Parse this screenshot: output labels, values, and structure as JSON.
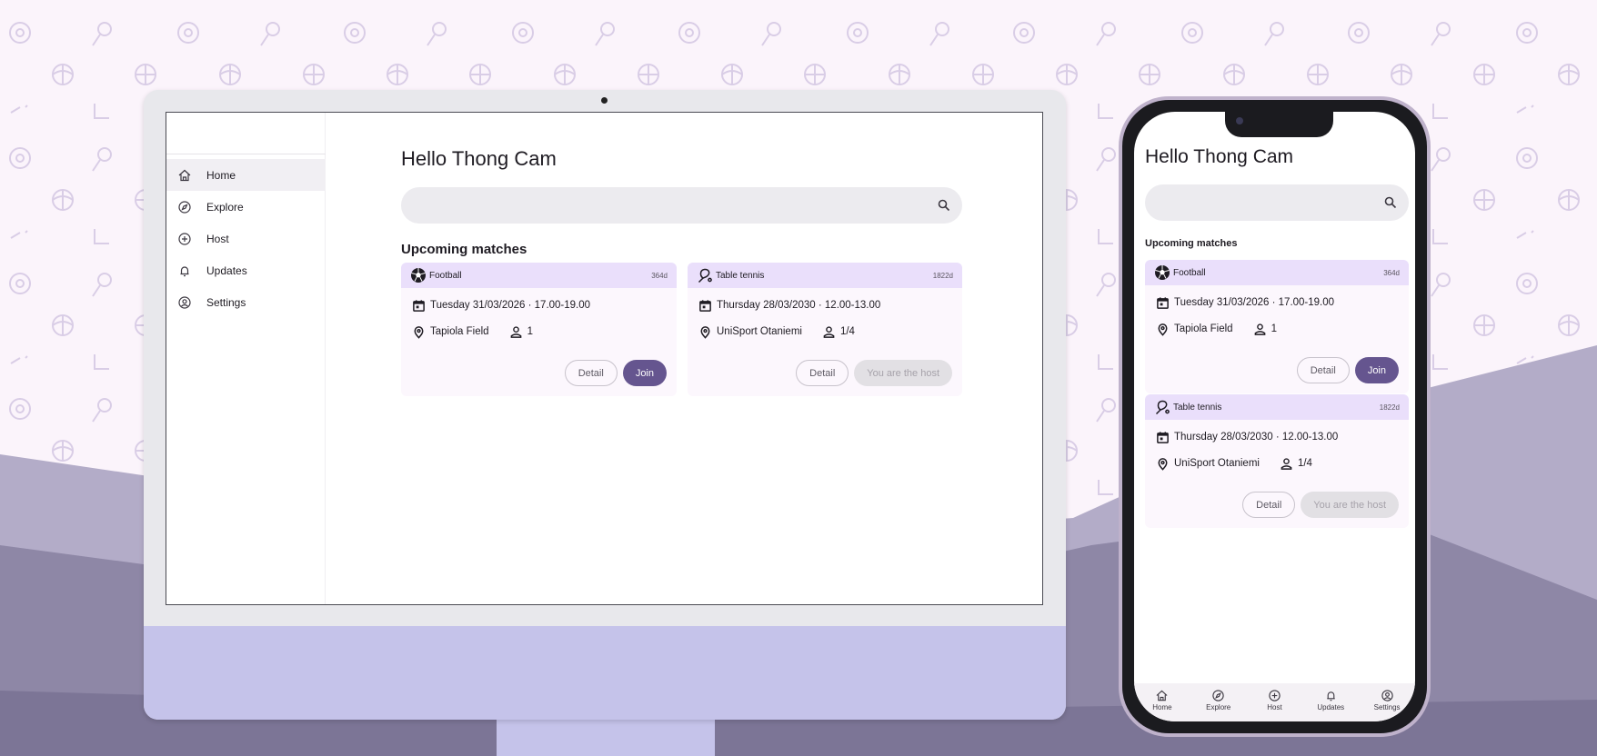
{
  "user": {
    "greeting": "Hello Thong Cam"
  },
  "search": {
    "placeholder": ""
  },
  "nav": {
    "items": [
      {
        "label": "Home",
        "icon": "home-icon",
        "active": true
      },
      {
        "label": "Explore",
        "icon": "compass-icon"
      },
      {
        "label": "Host",
        "icon": "plus-circle-icon"
      },
      {
        "label": "Updates",
        "icon": "bell-icon"
      },
      {
        "label": "Settings",
        "icon": "user-circle-icon"
      }
    ]
  },
  "upcoming": {
    "title": "Upcoming matches",
    "matches": [
      {
        "sport": "Football",
        "sport_icon": "football-icon",
        "days": "364d",
        "date": "Tuesday 31/03/2026 · 17.00-19.00",
        "location": "Tapiola Field",
        "participants": "1",
        "detail_label": "Detail",
        "action_label": "Join",
        "action_state": "enabled"
      },
      {
        "sport": "Table tennis",
        "sport_icon": "table-tennis-icon",
        "days": "1822d",
        "date": "Thursday 28/03/2030 · 12.00-13.00",
        "location": "UniSport Otaniemi",
        "participants": "1/4",
        "detail_label": "Detail",
        "action_label": "You are the host",
        "action_state": "disabled"
      }
    ]
  },
  "colors": {
    "accent": "#65558f",
    "card_header": "#eadffb",
    "card_bg": "#fcf7fd",
    "monitor_chin": "#c5c3ea",
    "hills": "#8e87a6"
  }
}
